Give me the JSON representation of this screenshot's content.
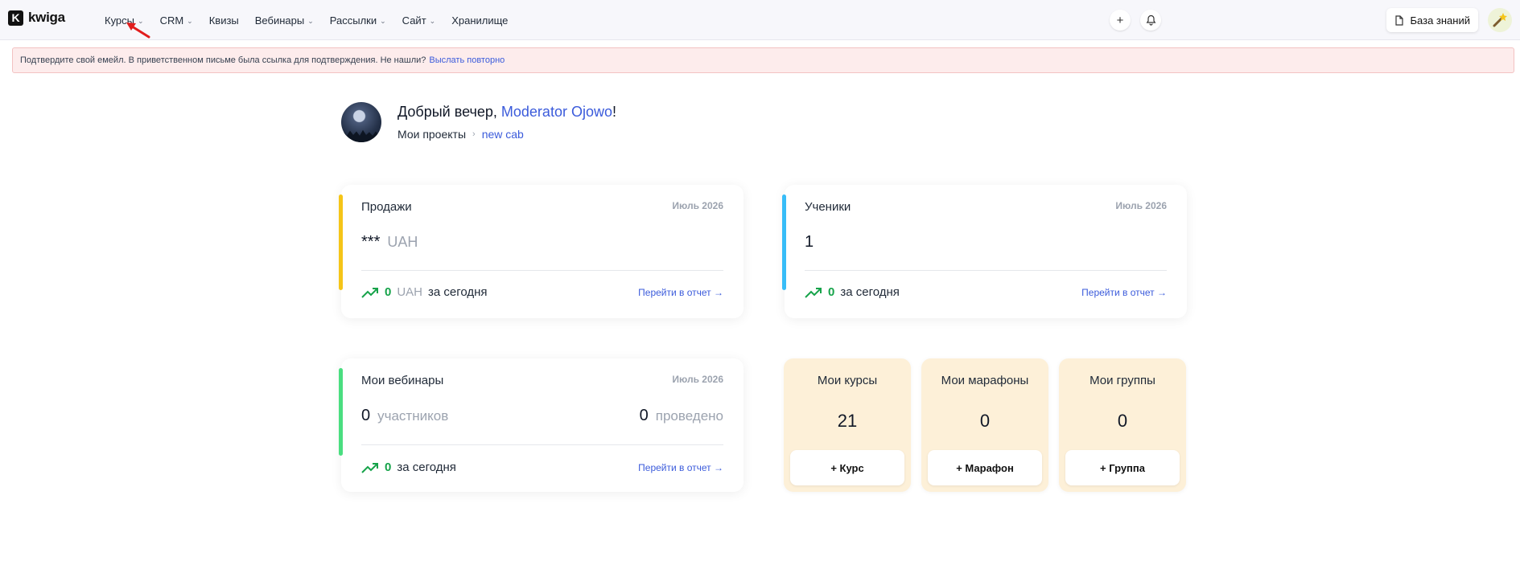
{
  "app": {
    "logo_text": "kwiga"
  },
  "nav": {
    "items": [
      {
        "label": "Курсы",
        "has_dropdown": true
      },
      {
        "label": "CRM",
        "has_dropdown": true
      },
      {
        "label": "Квизы",
        "has_dropdown": false
      },
      {
        "label": "Вебинары",
        "has_dropdown": true
      },
      {
        "label": "Рассылки",
        "has_dropdown": true
      },
      {
        "label": "Сайт",
        "has_dropdown": true
      },
      {
        "label": "Хранилище",
        "has_dropdown": false
      }
    ]
  },
  "header": {
    "plus_icon": "+",
    "knowledge_base_label": "База знаний"
  },
  "alert": {
    "text": "Подтвердите свой емейл. В приветственном письме была ссылка для подтверждения. Не нашли?",
    "link": "Выслать повторно"
  },
  "greeting": {
    "prefix": "Добрый вечер, ",
    "user": "Moderator Ojowo",
    "suffix": "!",
    "breadcrumb_root": "Мои проекты",
    "breadcrumb_current": "new cab"
  },
  "sales": {
    "title": "Продажи",
    "date": "Июль 2026",
    "value": "***",
    "unit": "UAH",
    "today_value": "0",
    "today_unit": "UAH",
    "today_label": "за сегодня",
    "link": "Перейти в отчет →"
  },
  "students": {
    "title": "Ученики",
    "date": "Июль 2026",
    "value": "1",
    "today_value": "0",
    "today_label": "за сегодня",
    "link": "Перейти в отчет →"
  },
  "webinars": {
    "title": "Мои вебинары",
    "date": "Июль 2026",
    "participants_value": "0",
    "participants_label": "участников",
    "held_value": "0",
    "held_label": "проведено",
    "today_value": "0",
    "today_label": "за сегодня",
    "link": "Перейти в отчет →"
  },
  "tiles": [
    {
      "title": "Мои курсы",
      "count": "21",
      "button": "+ Курс"
    },
    {
      "title": "Мои марафоны",
      "count": "0",
      "button": "+ Марафон"
    },
    {
      "title": "Мои группы",
      "count": "0",
      "button": "+ Группа"
    }
  ],
  "colors": {
    "accent_link": "#3b5bdb",
    "sales_accent": "#f5c518",
    "students_accent": "#38bdf8",
    "webinars_accent": "#4ade80",
    "growth_green": "#16a34a",
    "tile_bg": "#fdf0d8"
  }
}
